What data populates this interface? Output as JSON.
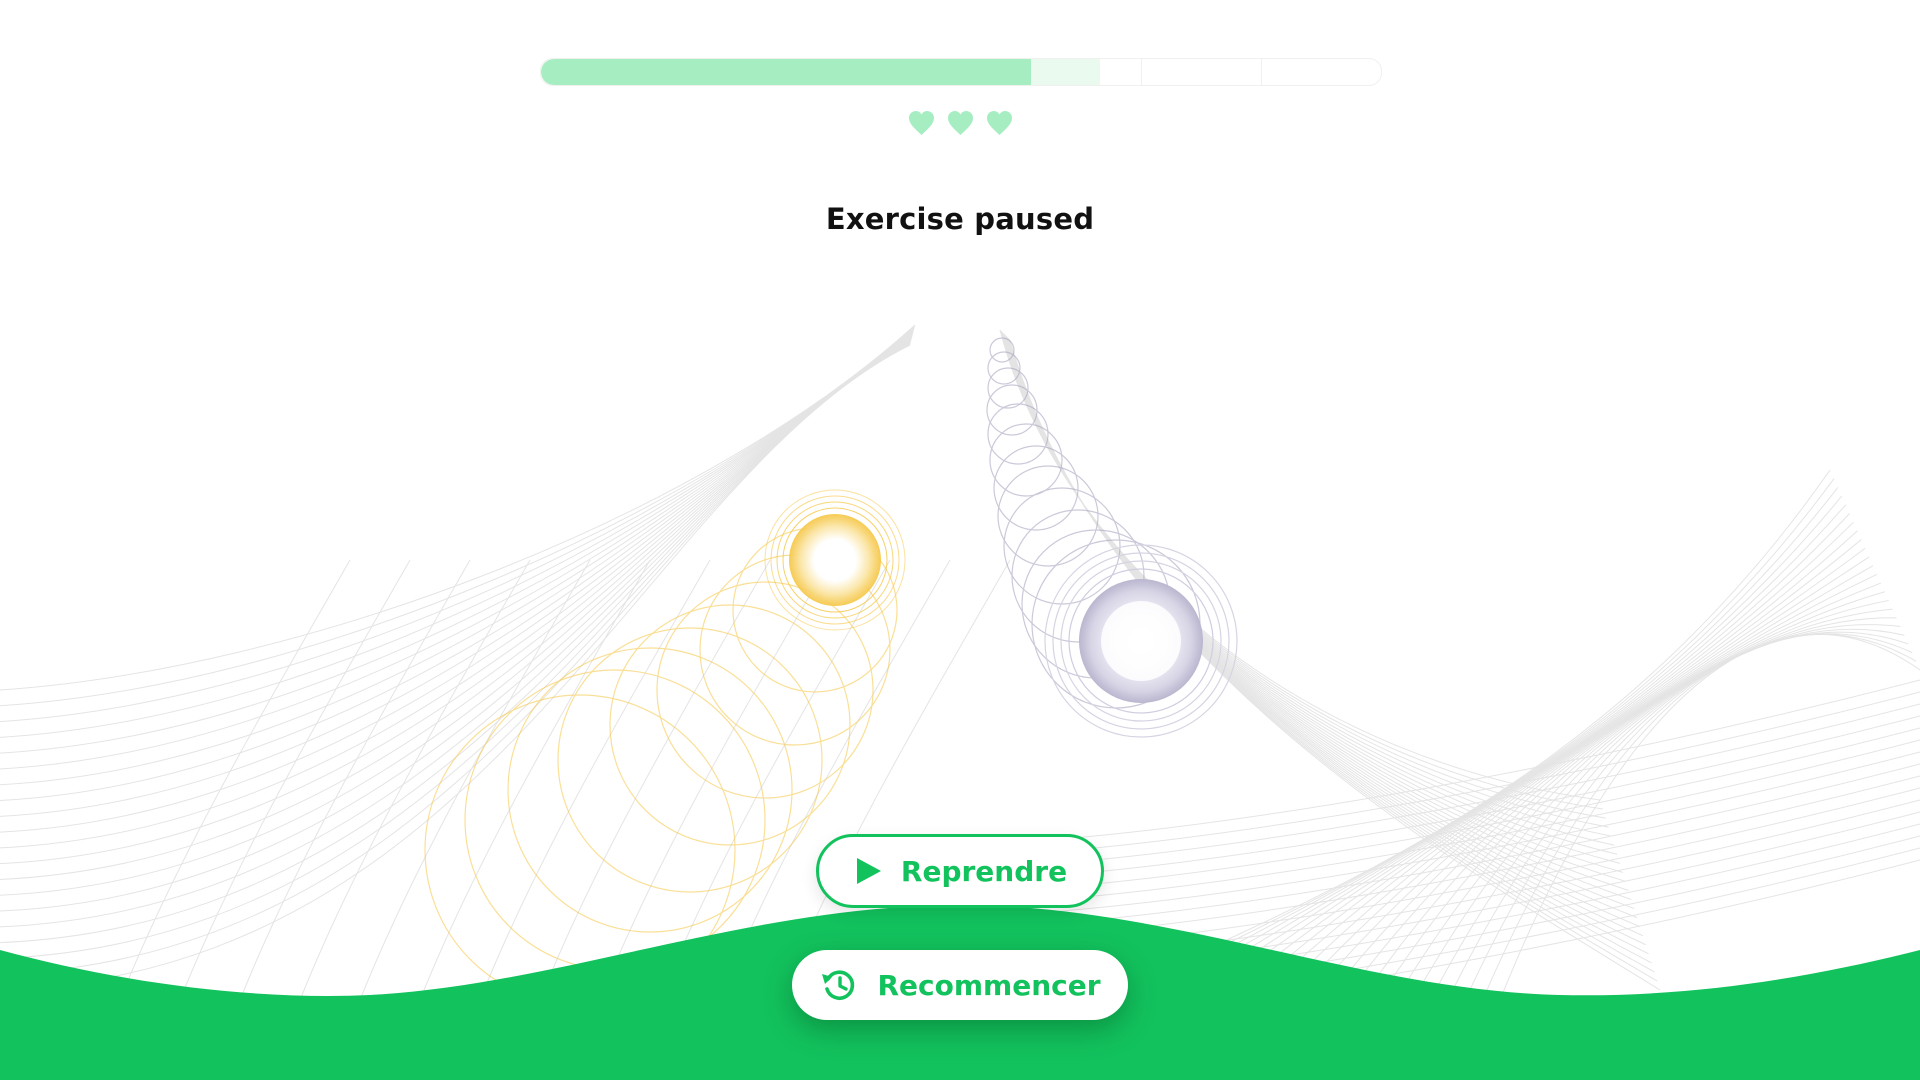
{
  "progress": {
    "segments": 7,
    "completed_fraction": 0.583,
    "current_segment_fraction": 0.083,
    "fill_color": "#a6edc2",
    "current_color": "#eafaef"
  },
  "lives": {
    "count": 3,
    "icon": "heart-icon",
    "color": "#a6edc2"
  },
  "status": {
    "title": "Exercise paused"
  },
  "actions": {
    "resume_label": "Reprendre",
    "resume_icon": "play-icon",
    "restart_label": "Recommencer",
    "restart_icon": "restart-icon"
  },
  "colors": {
    "accent": "#12c25d",
    "left_orb": "#f5c542",
    "right_orb": "#b9b6cf",
    "wave": "#12c25d"
  }
}
